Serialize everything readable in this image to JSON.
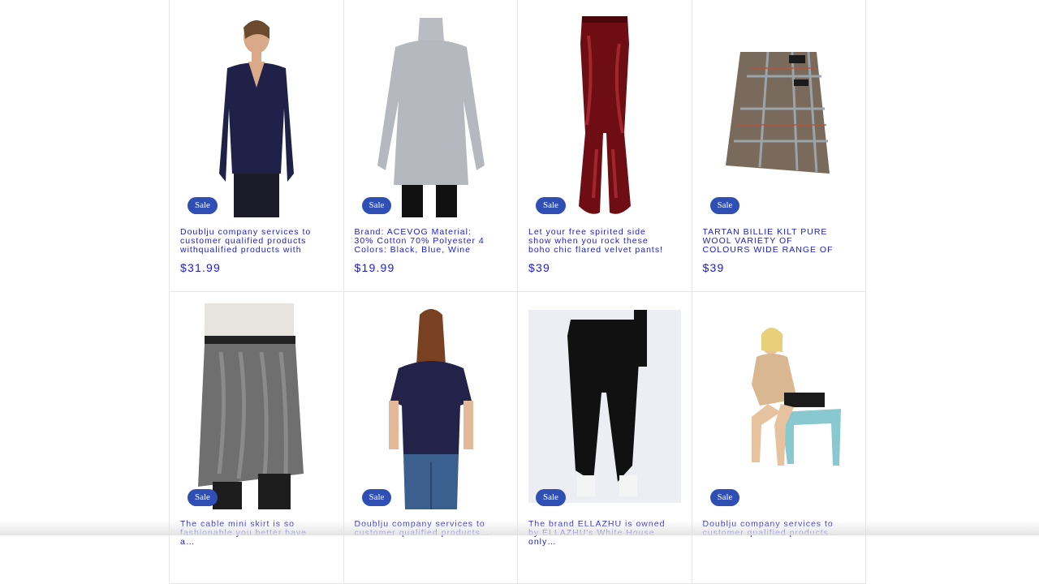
{
  "products": [
    {
      "title": "Doublju company services to customer qualified products withqualified products with",
      "price": "$31.99",
      "badge": "Sale",
      "image": "navy-v-neck-sweater"
    },
    {
      "title": "Brand: ACEVOG Material: 30% Cotton 70% Polyester 4 Colors: Black, Blue, Wine Red, Beige…",
      "price": "$19.99",
      "badge": "Sale",
      "image": "grey-turtleneck-dress"
    },
    {
      "title": "Let your free spirited side show when you rock these boho chic flared velvet pants! The pants…",
      "price": "$39",
      "badge": "Sale",
      "image": "red-velvet-flare-pants"
    },
    {
      "title": "TARTAN BILLIE KILT PURE WOOL VARIETY OF COLOURS WIDE RANGE OF SIZES…",
      "price": "$39",
      "badge": "Sale",
      "image": "tartan-kilt"
    },
    {
      "title": "The cable mini skirt is so fashionable you better have a…",
      "price": "",
      "badge": "Sale",
      "image": "cable-knit-mini-skirt"
    },
    {
      "title": "Doublju company services to customer qualified products…",
      "price": "",
      "badge": "Sale",
      "image": "navy-tee"
    },
    {
      "title": "The brand ELLAZHU is owned by ELLAZHU's White House only…",
      "price": "",
      "badge": "Sale",
      "image": "black-harem-pants"
    },
    {
      "title": "Doublju company services to customer qualified products…",
      "price": "",
      "badge": "Sale",
      "image": "beige-cardigan"
    }
  ],
  "colors": {
    "badge": "#2f4fb5",
    "link": "#1a1ad6",
    "border": "#e6e6e6"
  }
}
